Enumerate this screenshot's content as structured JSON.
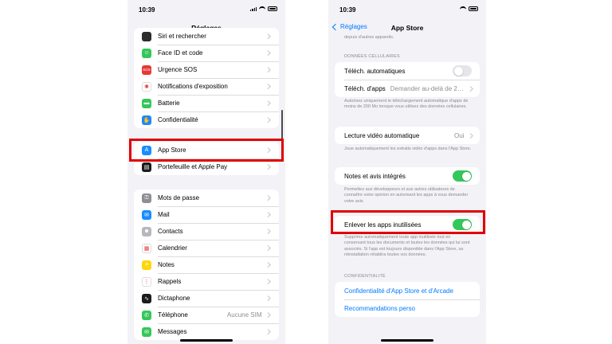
{
  "left": {
    "status_time": "10:39",
    "title": "Réglages",
    "group1": [
      {
        "label": "Siri et rechercher",
        "icon": "siri-icon",
        "color": "#2c2c2e",
        "glyph": ""
      },
      {
        "label": "Face ID et code",
        "icon": "face-id-icon",
        "color": "#34c759",
        "glyph": "☺"
      },
      {
        "label": "Urgence SOS",
        "icon": "sos-icon",
        "color": "#e53935",
        "glyph": "SOS"
      },
      {
        "label": "Notifications d'exposition",
        "icon": "exposure-notifications-icon",
        "color": "#ffffff",
        "glyph": "✺"
      },
      {
        "label": "Batterie",
        "icon": "battery-icon",
        "color": "#34c759",
        "glyph": "▬"
      },
      {
        "label": "Confidentialité",
        "icon": "privacy-hand-icon",
        "color": "#1e88ff",
        "glyph": "✋"
      }
    ],
    "group2": [
      {
        "label": "App Store",
        "icon": "app-store-icon",
        "color": "#1a8cff",
        "glyph": "A"
      },
      {
        "label": "Portefeuille et Apple Pay",
        "icon": "wallet-icon",
        "color": "#1c1c1e",
        "glyph": "▤"
      }
    ],
    "group3": [
      {
        "label": "Mots de passe",
        "icon": "key-icon",
        "color": "#8e8e93",
        "glyph": "⚿",
        "value": ""
      },
      {
        "label": "Mail",
        "icon": "mail-icon",
        "color": "#1a8cff",
        "glyph": "✉",
        "value": ""
      },
      {
        "label": "Contacts",
        "icon": "contacts-icon",
        "color": "#b8b8bc",
        "glyph": "☻",
        "value": ""
      },
      {
        "label": "Calendrier",
        "icon": "calendar-icon",
        "color": "#ffffff",
        "glyph": "▦",
        "value": ""
      },
      {
        "label": "Notes",
        "icon": "notes-icon",
        "color": "#ffd60a",
        "glyph": "≡",
        "value": ""
      },
      {
        "label": "Rappels",
        "icon": "reminders-icon",
        "color": "#ffffff",
        "glyph": "⋮",
        "value": ""
      },
      {
        "label": "Dictaphone",
        "icon": "voice-memos-icon",
        "color": "#1c1c1e",
        "glyph": "∿",
        "value": ""
      },
      {
        "label": "Téléphone",
        "icon": "phone-icon",
        "color": "#34c759",
        "glyph": "✆",
        "value": "Aucune SIM"
      },
      {
        "label": "Messages",
        "icon": "messages-icon",
        "color": "#34c759",
        "glyph": "✉",
        "value": ""
      }
    ]
  },
  "right": {
    "status_time": "10:39",
    "back_label": "Réglages",
    "title": "App Store",
    "top_clip_text": "depuis d'autres appareils.",
    "cellular_header": "DONNÉES CELLULAIRES",
    "auto_downloads_label": "Téléch. automatiques",
    "apps_download_label": "Téléch. d'apps",
    "apps_download_value": "Demander au-delà de 2…",
    "cellular_footer": "Autorisez uniquement le téléchargement automatique d'apps de moins de 200 Mo lorsque vous utilisez des données cellulaires.",
    "video_autoplay_label": "Lecture vidéo automatique",
    "video_autoplay_value": "Oui",
    "video_footer": "Joue automatiquement les extraits vidéo d'apps dans l'App Store.",
    "ratings_label": "Notes et avis intégrés",
    "ratings_footer": "Permettez aux développeurs et aux autres utilisateurs de connaître votre opinion en autorisant les apps à vous demander votre avis.",
    "offload_label": "Enlever les apps inutilisées",
    "offload_footer": "Supprime automatiquement toute app inutilisée tout en conservant tous les documents et toutes les données qui lui sont associés. Si l'app est toujours disponible dans l'App Store, sa réinstallation rétablira toutes vos données.",
    "privacy_header": "CONFIDENTIALITÉ",
    "privacy_link": "Confidentialité d'App Store et d'Arcade",
    "recommendations_link": "Recommandations perso",
    "toggles": {
      "auto_downloads": false,
      "ratings": true,
      "offload": true
    }
  },
  "colors": {
    "highlight": "#e00000",
    "toggle_on": "#34c759",
    "link": "#007aff"
  }
}
